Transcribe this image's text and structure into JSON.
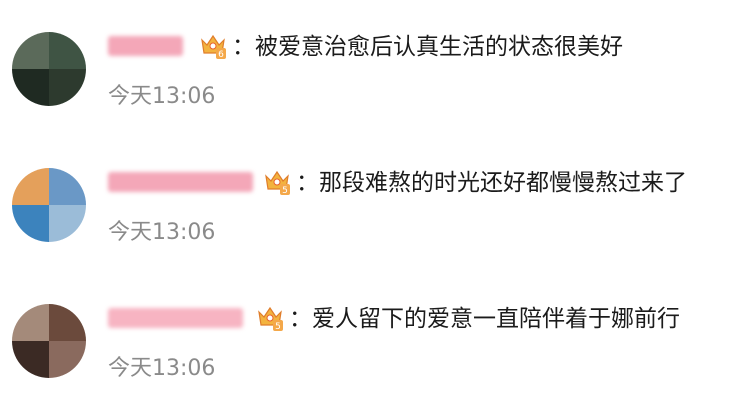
{
  "separator": "：",
  "comments": [
    {
      "vip_level": "6",
      "text": "被爱意治愈后认真生活的状态很美好",
      "timestamp": "今天13:06",
      "avatar_colors": [
        "#5b6a5a",
        "#3f5444",
        "#1f2a22",
        "#2d3a2e"
      ],
      "name_color": "#f4a7b8"
    },
    {
      "vip_level": "5",
      "text": "那段难熬的时光还好都慢慢熬过来了",
      "timestamp": "今天13:06",
      "avatar_colors": [
        "#e4a05b",
        "#6a98c6",
        "#3c83bd",
        "#9bbcd8"
      ],
      "name_color": "#f4a7b8"
    },
    {
      "vip_level": "5",
      "text": "爱人留下的爱意一直陪伴着于娜前行",
      "timestamp": "今天13:06",
      "avatar_colors": [
        "#a48a7a",
        "#6b4a3c",
        "#3b2a24",
        "#8a6a5e"
      ],
      "name_color": "#f7b4c2"
    }
  ]
}
